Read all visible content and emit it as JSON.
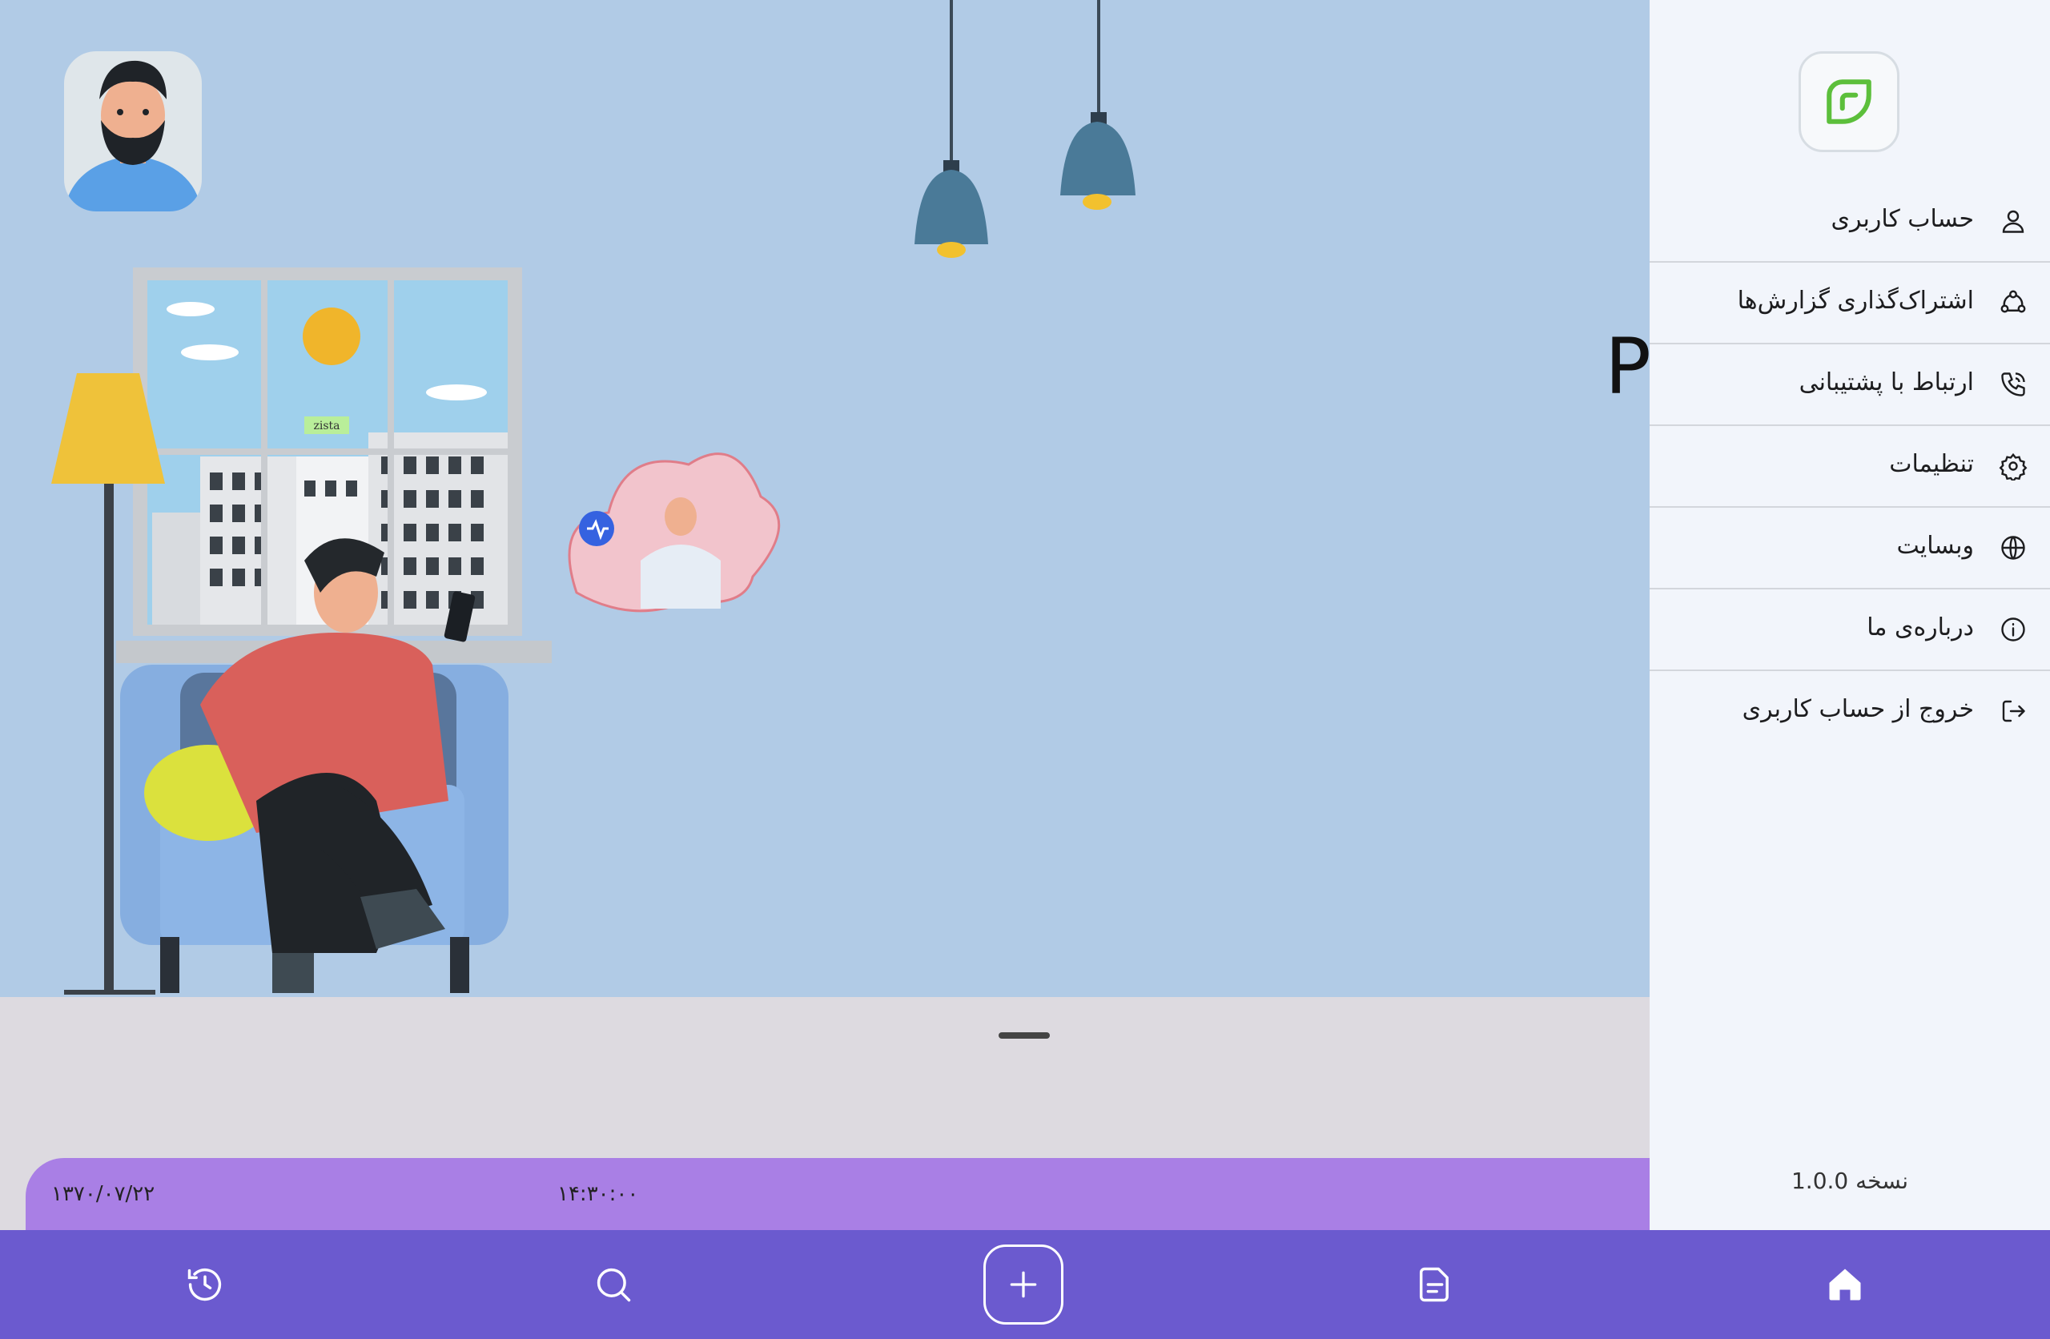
{
  "app": {
    "stray_char": "P"
  },
  "illustration": {
    "sign_text": "zista"
  },
  "drawer": {
    "logo_icon": "leaf-logo-icon",
    "items": [
      {
        "label": "حساب کاربری",
        "icon": "user-icon"
      },
      {
        "label": "اشتراک‌گذاری گزارش‌ها",
        "icon": "share-icon"
      },
      {
        "label": "ارتباط با پشتیبانی",
        "icon": "phone-icon"
      },
      {
        "label": "تنظیمات",
        "icon": "gear-icon"
      },
      {
        "label": "وبسایت",
        "icon": "globe-icon"
      },
      {
        "label": "درباره‌ی ما",
        "icon": "info-icon"
      },
      {
        "label": "خروج از حساب کاربری",
        "icon": "logout-icon"
      }
    ],
    "version": "نسخه 1.0.0"
  },
  "info_bar": {
    "date": "۱۳۷۰/۰۷/۲۲",
    "time": "۱۴:۳۰:۰۰"
  },
  "bottom_nav": {
    "items": [
      "history-icon",
      "search-icon",
      "add-icon",
      "report-icon",
      "home-icon"
    ]
  },
  "colors": {
    "nav": "#6b5acf",
    "info_bar": "#a97fe5",
    "drawer": "#f2f5fb",
    "logo_green": "#5cbf3b",
    "scene_bg": "#b1cbe6"
  }
}
